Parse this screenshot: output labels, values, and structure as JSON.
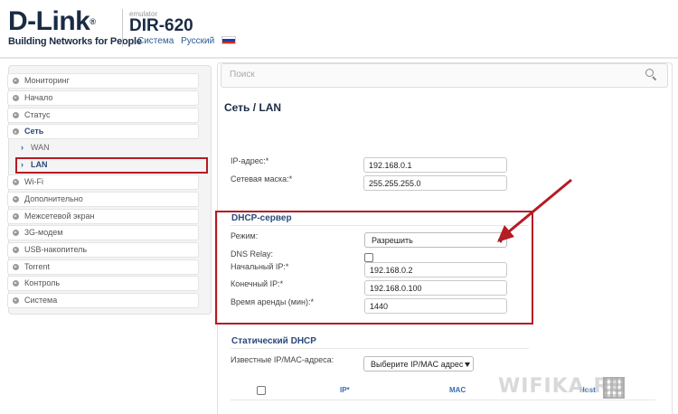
{
  "header": {
    "logo_text": "D-Link",
    "logo_reg": "®",
    "logo_tagline": "Building Networks for People",
    "emulator": "emulator",
    "model": "DIR-620",
    "link_system": "Система",
    "link_language": "Русский",
    "flag_colors": [
      "#ffffff",
      "#1c3fa0",
      "#d52b1e"
    ]
  },
  "sidebar": {
    "items": [
      {
        "label": "Мониторинг"
      },
      {
        "label": "Начало"
      },
      {
        "label": "Статус"
      },
      {
        "label": "Сеть"
      },
      {
        "label": "WAN"
      },
      {
        "label": "LAN"
      },
      {
        "label": "Wi-Fi"
      },
      {
        "label": "Дополнительно"
      },
      {
        "label": "Межсетевой экран"
      },
      {
        "label": "3G-модем"
      },
      {
        "label": "USB-накопитель"
      },
      {
        "label": "Torrent"
      },
      {
        "label": "Контроль"
      },
      {
        "label": "Система"
      }
    ]
  },
  "search": {
    "placeholder": "Поиск"
  },
  "page": {
    "title": "Сеть /  LAN"
  },
  "lan": {
    "ip_label": "IP-адрес:*",
    "ip_value": "192.168.0.1",
    "mask_label": "Сетевая маска:*",
    "mask_value": "255.255.255.0"
  },
  "dhcp": {
    "title": "DHCP-сервер",
    "mode_label": "Режим:",
    "mode_value": "Разрешить",
    "relay_label": "DNS Relay:",
    "start_label": "Начальный IP:*",
    "start_value": "192.168.0.2",
    "end_label": "Конечный IP:*",
    "end_value": "192.168.0.100",
    "lease_label": "Время аренды (мин):*",
    "lease_value": "1440"
  },
  "static_dhcp": {
    "title": "Статический DHCP",
    "known_label": "Известные IP/MAC-адреса:",
    "known_select": "Выберите IP/MAC адрес",
    "columns": [
      "IP*",
      "MAC",
      "Host"
    ]
  },
  "watermark": "WIFIKA.RU",
  "accent_colors": {
    "highlight_red": "#b51c24",
    "nav_blue": "#2b4a7a",
    "link_blue": "#3a6db3"
  }
}
